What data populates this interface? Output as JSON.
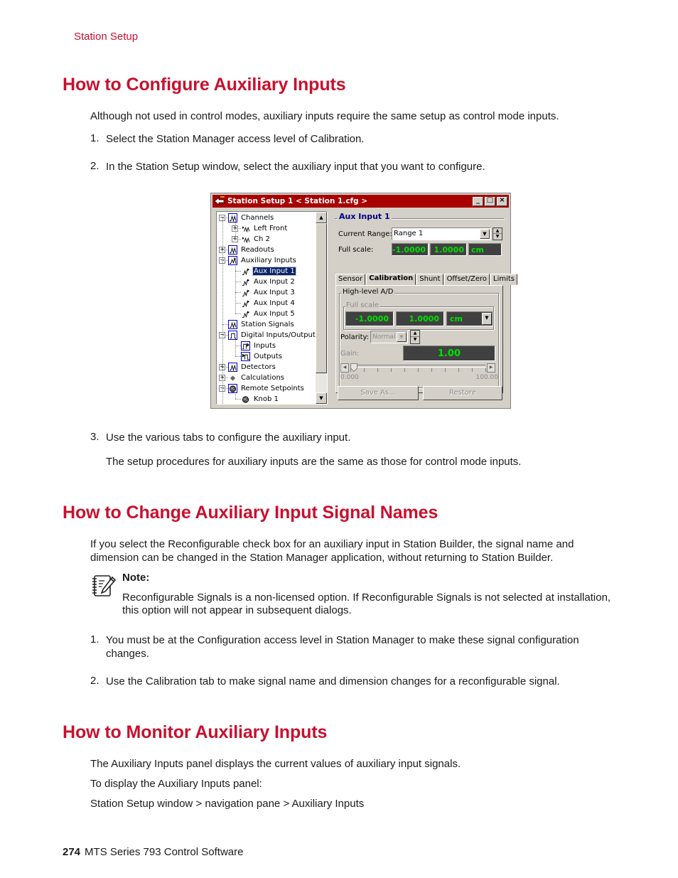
{
  "header": {
    "running_head": "Station Setup"
  },
  "sections": [
    {
      "title": "How to Configure Auxiliary Inputs",
      "intro": "Although not used in control modes, auxiliary inputs require the same setup as control mode inputs.",
      "steps": [
        {
          "num": "1.",
          "text": "Select the Station Manager access level of Calibration."
        },
        {
          "num": "2.",
          "text": "In the Station Setup window, select the auxiliary input that you want to configure."
        },
        {
          "num": "3.",
          "text": "Use the various tabs to configure the auxiliary input."
        }
      ],
      "step3_detail": "The setup procedures for auxiliary inputs are the same as those for control mode inputs."
    },
    {
      "title": "How to Change Auxiliary Input Signal Names",
      "intro_line1": "If you select the Reconfigurable check box for an auxiliary input in Station Builder, the signal name and",
      "intro_line2": "dimension can be changed in the Station Manager application, without returning to Station Builder.",
      "note": {
        "label": "Note:",
        "line1": "Reconfigurable Signals is a non-licensed option. If Reconfigurable Signals is not selected at installation,",
        "line2": "this option will not appear in subsequent dialogs."
      },
      "steps": [
        {
          "num": "1.",
          "line1": "You must be at the Configuration access level in Station Manager to make these signal configuration",
          "line2": "changes."
        },
        {
          "num": "2.",
          "line1": "Use the Calibration tab to make signal name and dimension changes for a reconfigurable signal."
        }
      ]
    },
    {
      "title": "How to Monitor Auxiliary Inputs",
      "p1": "The Auxiliary Inputs panel displays the current values of auxiliary input signals.",
      "p2": "To display the Auxiliary Inputs panel:",
      "p3": "Station Setup window > navigation pane > Auxiliary Inputs"
    }
  ],
  "window": {
    "title": "Station Setup 1 < Station 1.cfg >",
    "controls": {
      "minimize": "_",
      "maximize": "□",
      "close": "×"
    },
    "tree": [
      {
        "label": "Channels",
        "icon": "wave-icon",
        "level": 0,
        "expander": "−"
      },
      {
        "label": "Left Front",
        "icon": "channel-icon",
        "level": 1,
        "expander": "+"
      },
      {
        "label": "Ch 2",
        "icon": "channel-icon",
        "level": 1,
        "expander": "+"
      },
      {
        "label": "Readouts",
        "icon": "wave-icon",
        "level": 0,
        "expander": "+"
      },
      {
        "label": "Auxiliary Inputs",
        "icon": "aux-wave-icon",
        "level": 0,
        "expander": "−"
      },
      {
        "label": "Aux Input 1",
        "icon": "aux-input-icon",
        "level": 1,
        "selected": true
      },
      {
        "label": "Aux Input 2",
        "icon": "aux-input-icon",
        "level": 1
      },
      {
        "label": "Aux Input 3",
        "icon": "aux-input-icon",
        "level": 1
      },
      {
        "label": "Aux Input 4",
        "icon": "aux-input-icon",
        "level": 1
      },
      {
        "label": "Aux Input 5",
        "icon": "aux-input-icon",
        "level": 1
      },
      {
        "label": "Station Signals",
        "icon": "wave-icon",
        "level": 0
      },
      {
        "label": "Digital Inputs/Outputs",
        "icon": "digital-icon",
        "level": 0,
        "expander": "−"
      },
      {
        "label": "Inputs",
        "icon": "digital-input-icon",
        "level": 1
      },
      {
        "label": "Outputs",
        "icon": "digital-output-icon",
        "level": 1
      },
      {
        "label": "Detectors",
        "icon": "wave-icon",
        "level": 0,
        "expander": "+"
      },
      {
        "label": "Calculations",
        "icon": "diamond-icon",
        "level": 0,
        "expander": "+"
      },
      {
        "label": "Remote Setpoints",
        "icon": "knob-icon",
        "level": 0,
        "expander": "−"
      },
      {
        "label": "Knob 1",
        "icon": "knob-icon",
        "level": 1
      }
    ],
    "panel": {
      "group_title": "Aux Input 1",
      "current_range_label": "Current Range:",
      "current_range_value": "Range 1",
      "full_scale_label": "Full scale:",
      "full_scale_min": "-1.0000",
      "full_scale_max": "1.0000",
      "full_scale_unit": "cm",
      "tabs": [
        "Sensor",
        "Calibration",
        "Shunt",
        "Offset/Zero",
        "Limits"
      ],
      "active_tab": "Calibration",
      "hl_group": "High-level A/D",
      "fs_group": "Full scale",
      "hl_min": "-1.0000",
      "hl_max": "1.0000",
      "hl_unit": "cm",
      "polarity_label": "Polarity:",
      "polarity_value": "Normal",
      "gain_label": "Gain:",
      "gain_value": "1.00",
      "slider_min": "0.000",
      "slider_max": "100.00",
      "slider_value_fraction": 0.01,
      "save_as": "Save As...",
      "restore": "Restore"
    }
  },
  "footer": {
    "page_number": "274",
    "doc_title": "MTS Series 793 Control Software"
  },
  "colors": {
    "accent": "#c8102e",
    "titlebar": "#a80000",
    "display_bg": "#404040",
    "display_fg": "#00e000"
  }
}
